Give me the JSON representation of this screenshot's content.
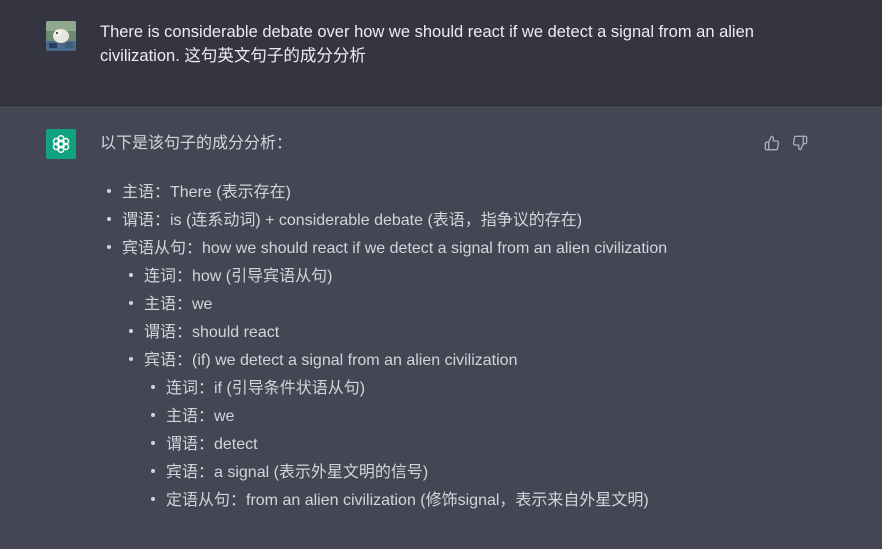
{
  "user_message": {
    "text": "There is considerable debate over how we should react if we detect a signal from an alien civilization. 这句英文句子的成分分析"
  },
  "assistant_message": {
    "intro": "以下是该句子的成分分析：",
    "items": [
      {
        "text": "主语：There (表示存在)",
        "children": []
      },
      {
        "text": "谓语：is (连系动词) + considerable debate (表语，指争议的存在)",
        "children": []
      },
      {
        "text": "宾语从句：how we should react if we detect a signal from an alien civilization",
        "children": [
          {
            "text": "连词：how (引导宾语从句)",
            "children": []
          },
          {
            "text": "主语：we",
            "children": []
          },
          {
            "text": "谓语：should react",
            "children": []
          },
          {
            "text": "宾语：(if) we detect a signal from an alien civilization",
            "children": [
              {
                "text": "连词：if (引导条件状语从句)"
              },
              {
                "text": "主语：we"
              },
              {
                "text": "谓语：detect"
              },
              {
                "text": "宾语：a signal (表示外星文明的信号)"
              },
              {
                "text": "定语从句：from an alien civilization (修饰signal，表示来自外星文明)"
              }
            ]
          }
        ]
      }
    ]
  },
  "feedback": {
    "thumbs_up_icon": "thumbs-up-icon",
    "thumbs_down_icon": "thumbs-down-icon"
  },
  "colors": {
    "user_bg": "#343541",
    "assistant_bg": "#444654",
    "accent": "#10a37f",
    "text": "#d1d5db"
  }
}
